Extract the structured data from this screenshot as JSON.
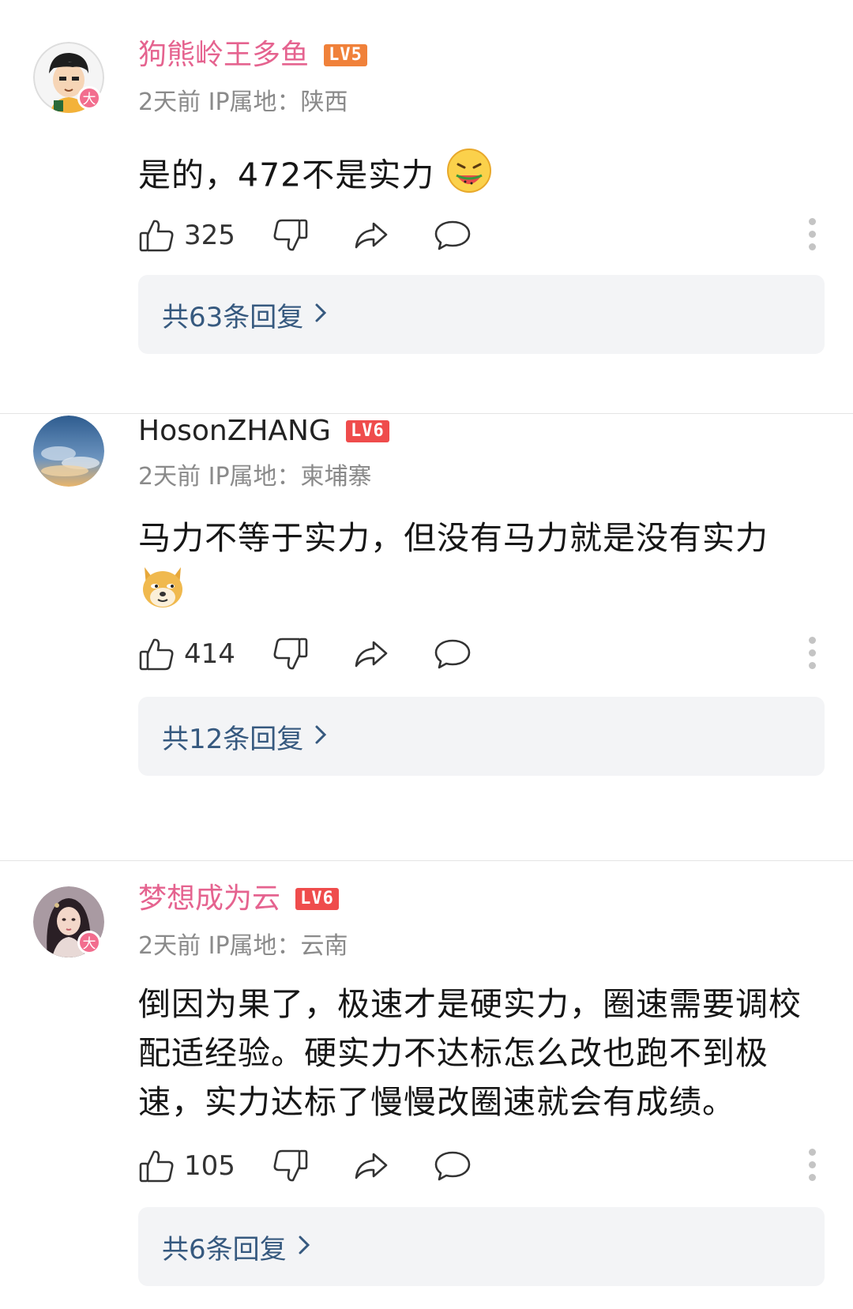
{
  "comments": [
    {
      "username": "狗熊岭王多鱼",
      "level": "LV5",
      "meta": "2天前 IP属地：陕西",
      "text": "是的，472不是实力",
      "emoji": "watermelon-face-emoji",
      "likes": "325",
      "replies": "共63条回复",
      "badge": "大"
    },
    {
      "username": "HosonZHANG",
      "level": "LV6",
      "meta": "2天前 IP属地：柬埔寨",
      "text": "马力不等于实力，但没有马力就是没有实力",
      "emoji": "doge-emoji",
      "likes": "414",
      "replies": "共12条回复"
    },
    {
      "username": "梦想成为云",
      "level": "LV6",
      "meta": "2天前 IP属地：云南",
      "text": "倒因为果了，极速才是硬实力，圈速需要调校配适经验。硬实力不达标怎么改也跑不到极速，实力达标了慢慢改圈速就会有成绩。",
      "likes": "105",
      "replies": "共6条回复",
      "badge": "大"
    }
  ],
  "colors": {
    "username_pink": "#e5638f",
    "reply_link": "#36597f",
    "level_red": "#ef4c4c",
    "level_orange": "#f0813a"
  }
}
